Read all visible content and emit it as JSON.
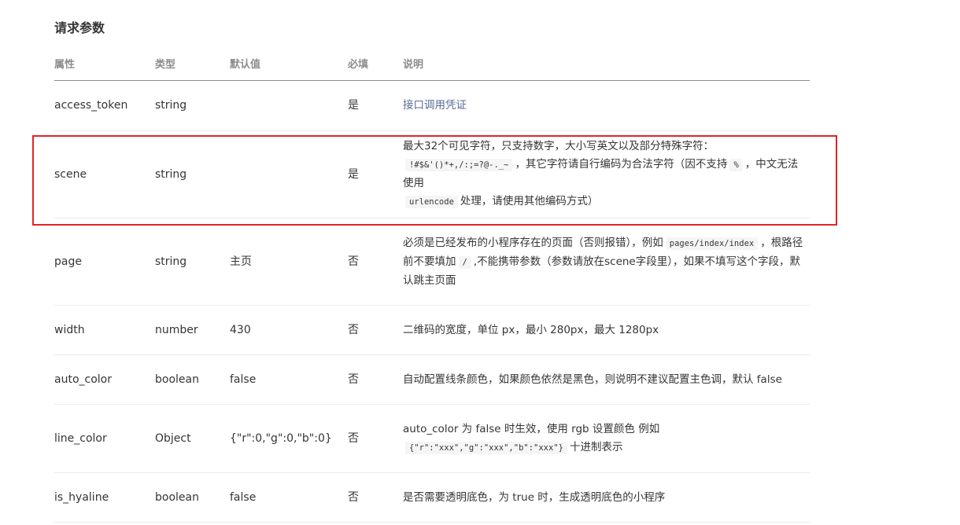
{
  "section_title": "请求参数",
  "table": {
    "headers": {
      "name": "属性",
      "type": "类型",
      "default": "默认值",
      "required": "必填",
      "desc": "说明"
    },
    "rows": [
      {
        "name": "access_token",
        "type": "string",
        "default": "",
        "required": "是",
        "desc": {
          "a": "接口调用凭证"
        }
      },
      {
        "name": "scene",
        "type": "string",
        "default": "",
        "required": "是",
        "desc": {
          "a": "最大32个可见字符，只支持数字，大小写英文以及部分特殊字符：",
          "code1": "!#$&'()*+,/:;=?@-._~",
          "b": "，其它字符请自行编码为合法字符（因不支持",
          "code2": "%",
          "c": "，中文无法使用",
          "code3": "urlencode",
          "d": "处理，请使用其他编码方式）"
        }
      },
      {
        "name": "page",
        "type": "string",
        "default": "主页",
        "required": "否",
        "desc": {
          "a": "必须是已经发布的小程序存在的页面（否则报错），例如",
          "code1": "pages/index/index",
          "b": "，根路径前不要填加",
          "code2": "/",
          "c": ",不能携带参数（参数请放在scene字段里），如果不填写这个字段，默认跳主页面"
        }
      },
      {
        "name": "width",
        "type": "number",
        "default": "430",
        "required": "否",
        "desc": {
          "a": "二维码的宽度，单位 px，最小 280px，最大 1280px"
        }
      },
      {
        "name": "auto_color",
        "type": "boolean",
        "default": "false",
        "required": "否",
        "desc": {
          "a": "自动配置线条颜色，如果颜色依然是黑色，则说明不建议配置主色调，默认 false"
        }
      },
      {
        "name": "line_color",
        "type": "Object",
        "default": "{\"r\":0,\"g\":0,\"b\":0}",
        "required": "否",
        "desc": {
          "a": "auto_color 为 false 时生效，使用 rgb 设置颜色 例如",
          "code1": "{\"r\":\"xxx\",\"g\":\"xxx\",\"b\":\"xxx\"}",
          "b": "十进制表示"
        }
      },
      {
        "name": "is_hyaline",
        "type": "boolean",
        "default": "false",
        "required": "否",
        "desc": {
          "a": "是否需要透明底色，为 true 时，生成透明底色的小程序"
        }
      }
    ]
  },
  "colors": {
    "highlight": "#e0242a",
    "link": "#576b95"
  }
}
